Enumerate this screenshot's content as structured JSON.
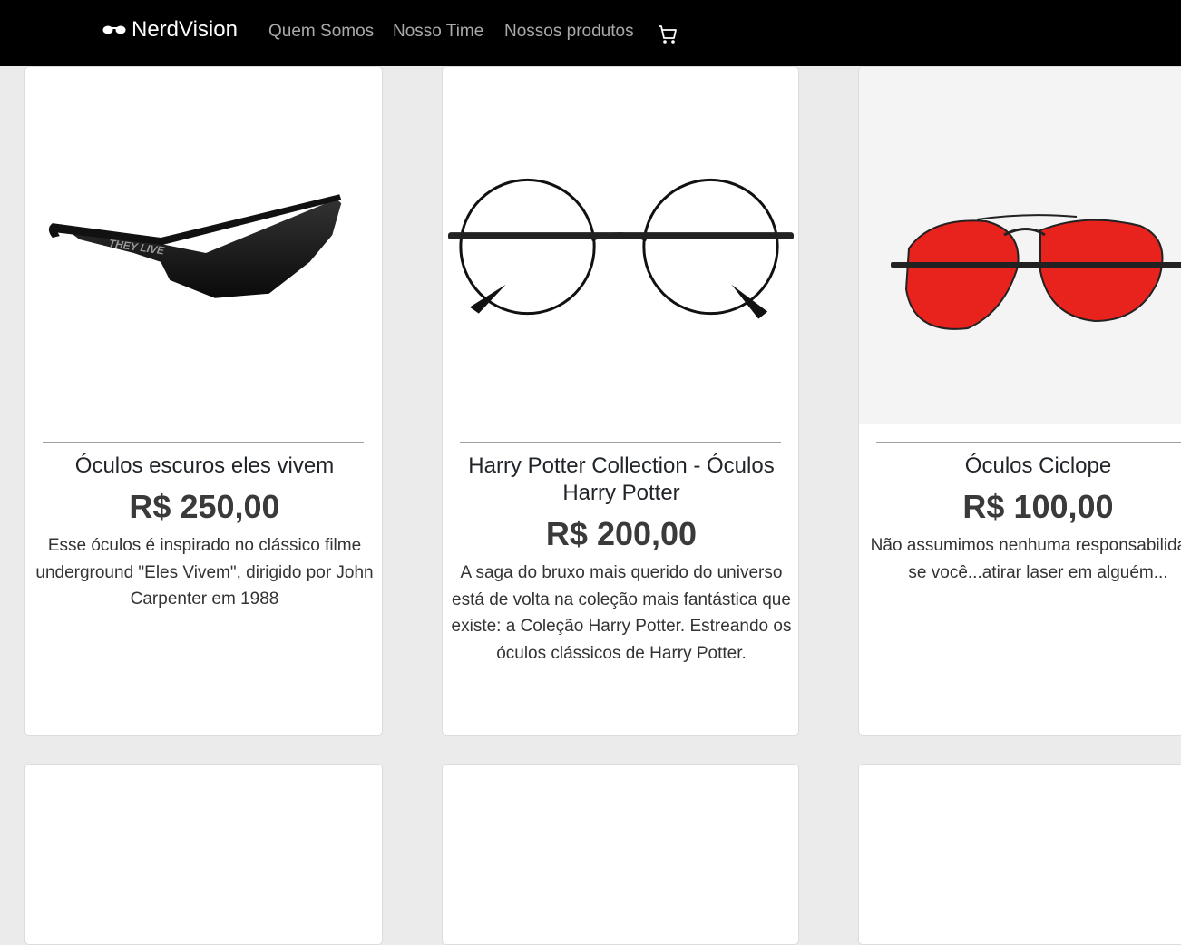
{
  "nav": {
    "brand": "NerdVision",
    "links": [
      "Quem Somos",
      "Nosso Time",
      "Nossos produtos"
    ]
  },
  "products": [
    {
      "title": "Óculos escuros eles vivem",
      "price": "R$ 250,00",
      "description": "Esse óculos é inspirado no clássico filme underground \"Eles Vivem\", dirigido por John Carpenter em 1988",
      "image_text": "THEY LIVE"
    },
    {
      "title": "Harry Potter Collection - Óculos Harry Potter",
      "price": "R$ 200,00",
      "description": "A saga do bruxo mais querido do universo está de volta na coleção mais fantástica que existe: a Coleção Harry Potter. Estreando os óculos clássicos de Harry Potter."
    },
    {
      "title": "Óculos Ciclope",
      "price": "R$ 100,00",
      "description": "Não assumimos nenhuma responsabilidade se você...atirar laser em alguém..."
    }
  ],
  "colors": {
    "navbar": "#000000",
    "background": "#ebebeb",
    "lens_red": "#e8231e"
  }
}
